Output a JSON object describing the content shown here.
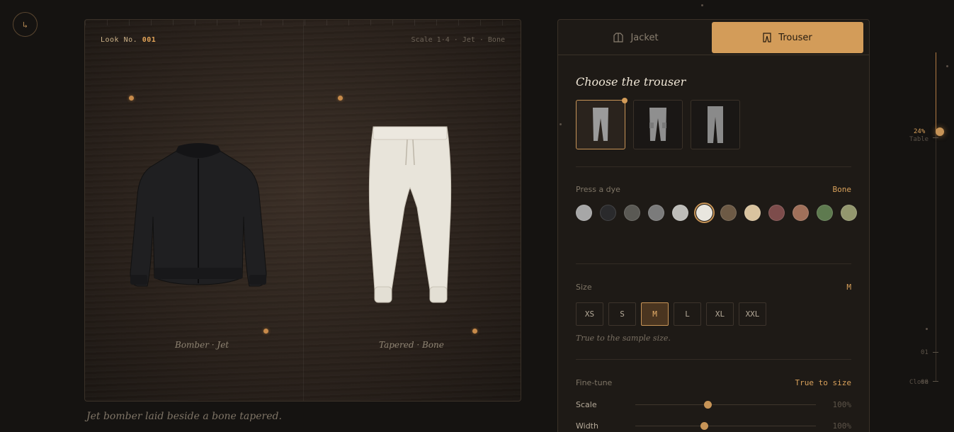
{
  "logo": {
    "icon": "hanger-icon",
    "glyph": "↳"
  },
  "stage": {
    "look_prefix": "Look No.",
    "look_number": "001",
    "scale_info": "Scale 1·4 · Jet · Bone",
    "jacket_caption": "Bomber · Jet",
    "trouser_caption": "Tapered · Bone"
  },
  "bottom_caption": "Jet bomber laid beside a bone tapered.",
  "tabs": [
    {
      "label": "Jacket",
      "icon": "jacket-icon",
      "active": false
    },
    {
      "label": "Trouser",
      "icon": "trouser-icon",
      "active": true
    }
  ],
  "panel": {
    "title": "Choose the trouser",
    "styles": [
      {
        "name": "tapered",
        "active": true
      },
      {
        "name": "cargo",
        "active": false
      },
      {
        "name": "straight",
        "active": false
      }
    ],
    "dye": {
      "label": "Press a dye",
      "value": "Bone",
      "colors": [
        "#a7a7a7",
        "#2a2a2c",
        "#5a5954",
        "#7b7b7b",
        "#bebdb9",
        "#e9e6df",
        "#6d5a45",
        "#d9c39f",
        "#7d4c4b",
        "#a0705a",
        "#5e7a4f",
        "#93976e"
      ],
      "active_index": 5
    },
    "size": {
      "label": "Size",
      "value": "M",
      "options": [
        "XS",
        "S",
        "M",
        "L",
        "XL",
        "XXL"
      ],
      "active": "M",
      "hint": "True to the sample size."
    },
    "finetune": {
      "label": "Fine-tune",
      "value": "True to size",
      "sliders": [
        {
          "name": "Scale",
          "value": "100%",
          "position": 0.4
        },
        {
          "name": "Width",
          "value": "100%",
          "position": 0.38
        }
      ]
    }
  },
  "rail": {
    "percent": "24%",
    "level_label": "Table",
    "tick_01": "01",
    "tick_close": "Close",
    "tick_close_num": "08",
    "level": 0.24
  }
}
